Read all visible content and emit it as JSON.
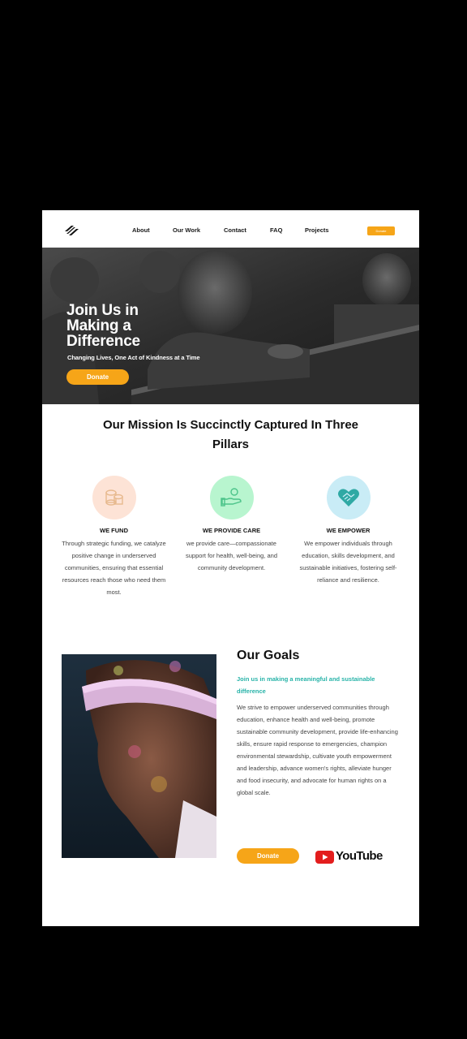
{
  "nav": {
    "logo_icon": "stripes-logo-icon",
    "links": [
      "About",
      "Our Work",
      "Contact",
      "FAQ",
      "Projects"
    ],
    "donate_label": "Donate"
  },
  "hero": {
    "title": "Join Us in Making a Difference",
    "subtitle": "Changing Lives, One Act of Kindness at a Time",
    "donate_label": "Donate"
  },
  "mission": {
    "title": "Our Mission Is Succinctly Captured In Three Pillars",
    "pillars": [
      {
        "title": "WE FUND",
        "text": "Through strategic funding, we catalyze positive change in underserved communities, ensuring that essential resources reach those who need them most.",
        "icon": "coins-icon",
        "color": "#fde3d6"
      },
      {
        "title": "WE PROVIDE CARE",
        "text": "we provide care—compassionate support for health, well-being, and community development.",
        "icon": "caring-hand-icon",
        "color": "#b8f5cf"
      },
      {
        "title": "WE EMPOWER",
        "text": "We empower individuals through education, skills development, and sustainable initiatives, fostering self-reliance and resilience.",
        "icon": "handshake-heart-icon",
        "color": "#c9ecf6"
      }
    ]
  },
  "goals": {
    "title": "Our Goals",
    "subtitle": "Join us in making a meaningful and sustainable difference",
    "text": "We strive to empower underserved communities through education, enhance health and well-being, promote sustainable community development, provide life-enhancing skills, ensure rapid response to emergencies, champion environmental stewardship, cultivate youth empowerment and leadership, advance women's rights, alleviate hunger and food insecurity, and advocate for human rights on a global scale.",
    "donate_label": "Donate",
    "youtube_label": "YouTube"
  },
  "colors": {
    "accent": "#f6a518",
    "teal": "#27b3a8"
  }
}
